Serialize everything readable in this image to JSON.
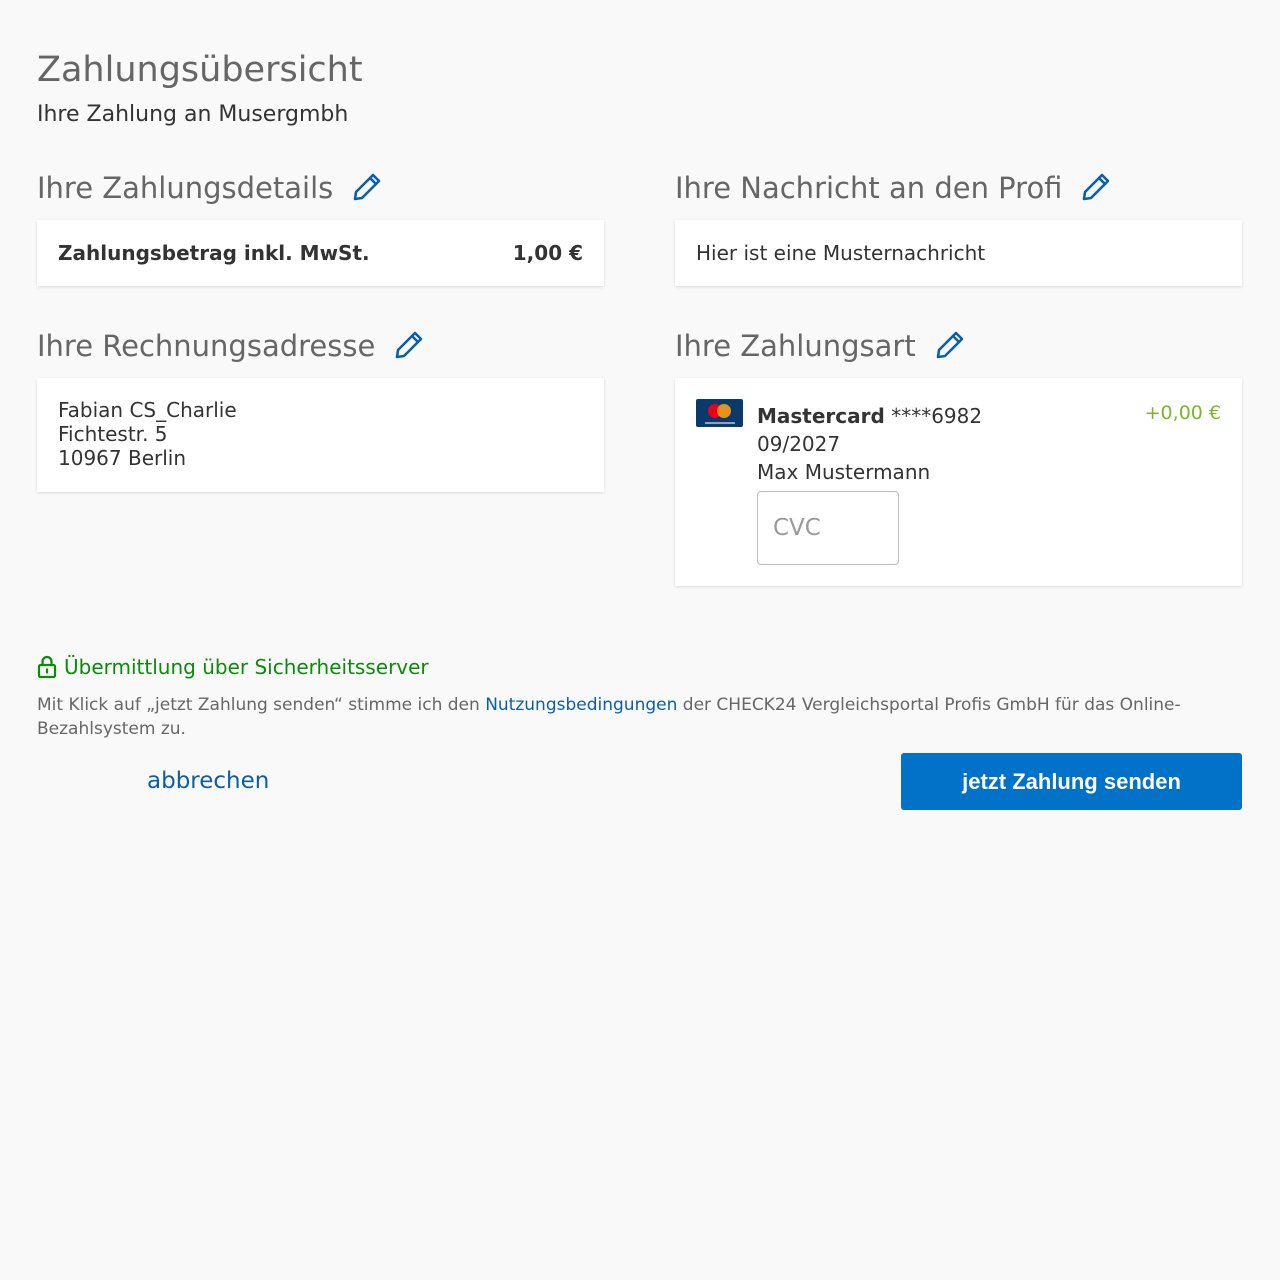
{
  "header": {
    "title": "Zahlungsübersicht",
    "subtitle": "Ihre Zahlung an Musergmbh"
  },
  "payment_details": {
    "title": "Ihre Zahlungsdetails",
    "amount_label": "Zahlungsbetrag inkl. MwSt.",
    "amount_value": "1,00 €"
  },
  "message": {
    "title": "Ihre Nachricht an den Profi",
    "text": "Hier ist eine Musternachricht"
  },
  "billing_address": {
    "title": "Ihre Rechnungsadresse",
    "lines": [
      "Fabian CS_Charlie",
      "Fichtestr. 5",
      "10967 Berlin"
    ]
  },
  "payment_method": {
    "title": "Ihre Zahlungsart",
    "brand": "Mastercard",
    "masked_number": "****6982",
    "expiry": "09/2027",
    "holder": "Max Mustermann",
    "fee": "+0,00 €",
    "cvc_placeholder": "CVC",
    "cvc_value": ""
  },
  "security": {
    "text": "Übermittlung über Sicherheitsserver",
    "icon": "lock-icon"
  },
  "terms": {
    "before": "Mit Klick auf „jetzt Zahlung senden“ stimme ich den ",
    "link": "Nutzungsbedingungen",
    "after": " der CHECK24 Vergleichsportal Profis GmbH für das Online-Bezahlsystem zu."
  },
  "actions": {
    "cancel_label": "abbrechen",
    "submit_label": "jetzt Zahlung senden"
  },
  "colors": {
    "accent": "#0271c8",
    "link": "#0a5fa8",
    "secure_green": "#0c8a0c",
    "fee_green": "#7ab829",
    "background": "#f9f9f9"
  }
}
